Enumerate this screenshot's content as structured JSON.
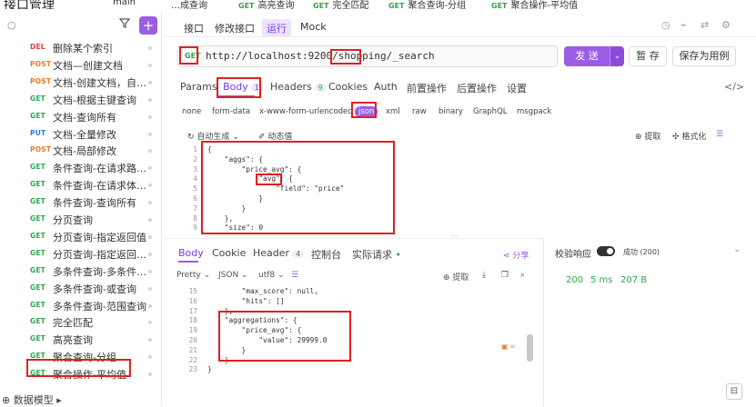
{
  "topbar": {
    "title": "接口管理",
    "tabs": [
      {
        "method": "",
        "label": "main"
      },
      {
        "method": "",
        "label": "…成查询"
      },
      {
        "method": "GET",
        "label": "高亮查询"
      },
      {
        "method": "GET",
        "label": "完全匹配"
      },
      {
        "method": "GET",
        "label": "聚合查询-分组"
      },
      {
        "method": "GET",
        "label": "聚合操作-平均值"
      }
    ]
  },
  "sidebar": {
    "search_icon": "search-icon",
    "add_label": "+",
    "items": [
      {
        "method": "DEL",
        "label": "删除某个索引"
      },
      {
        "method": "POST",
        "label": "文档—创建文档"
      },
      {
        "method": "POST",
        "label": "文档-创建文档，自定..."
      },
      {
        "method": "GET",
        "label": "文档-根据主键查询"
      },
      {
        "method": "GET",
        "label": "文档-查询所有"
      },
      {
        "method": "PUT",
        "label": "文档-全量修改"
      },
      {
        "method": "POST",
        "label": "文档-局部修改"
      },
      {
        "method": "GET",
        "label": "条件查询-在请求路径..."
      },
      {
        "method": "GET",
        "label": "条件查询-在请求体中..."
      },
      {
        "method": "GET",
        "label": "条件查询-查询所有"
      },
      {
        "method": "GET",
        "label": "分页查询"
      },
      {
        "method": "GET",
        "label": "分页查询-指定返回值"
      },
      {
        "method": "GET",
        "label": "分页查询-指定返回值..."
      },
      {
        "method": "GET",
        "label": "多条件查询-多条件同..."
      },
      {
        "method": "GET",
        "label": "多条件查询-或查询"
      },
      {
        "method": "GET",
        "label": "多条件查询-范围查询"
      },
      {
        "method": "GET",
        "label": "完全匹配"
      },
      {
        "method": "GET",
        "label": "高亮查询"
      },
      {
        "method": "GET",
        "label": "聚合查询-分组"
      },
      {
        "method": "GET",
        "label": "聚合操作-平均值"
      }
    ],
    "footer": "数据模型 ▸"
  },
  "main_tabs": [
    "接口",
    "修改接口",
    "运行",
    "Mock"
  ],
  "active_main_tab": "运行",
  "request": {
    "method": "GET",
    "url": "http://localhost:9200/shopping/_search",
    "send": "发 送",
    "save_draft": "暂 存",
    "save_as_case": "保存为用例"
  },
  "req_tabs": [
    {
      "label": "Params",
      "count": ""
    },
    {
      "label": "Body",
      "count": "1"
    },
    {
      "label": "Headers",
      "count": "9"
    },
    {
      "label": "Cookies",
      "count": ""
    },
    {
      "label": "Auth",
      "count": ""
    },
    {
      "label": "前置操作",
      "count": ""
    },
    {
      "label": "后置操作",
      "count": ""
    },
    {
      "label": "设置",
      "count": ""
    }
  ],
  "body_types": [
    "none",
    "form-data",
    "x-www-form-urlencoded",
    "json",
    "xml",
    "raw",
    "binary",
    "GraphQL",
    "msgpack"
  ],
  "body_active": "json",
  "editor_tools": {
    "auto_generate": "自动生成",
    "dynamic_value": "动态值",
    "extract": "提取",
    "format": "格式化"
  },
  "request_body_lines": [
    {
      "n": "1",
      "t": "{"
    },
    {
      "n": "2",
      "t": "    \"aggs\": {"
    },
    {
      "n": "3",
      "t": "        \"price_avg\": {"
    },
    {
      "n": "4",
      "t": "            \"avg\": {"
    },
    {
      "n": "5",
      "t": "                \"field\": \"price\""
    },
    {
      "n": "6",
      "t": "            }"
    },
    {
      "n": "7",
      "t": "        }"
    },
    {
      "n": "8",
      "t": "    },"
    },
    {
      "n": "9",
      "t": "    \"size\": 0"
    }
  ],
  "resp_tabs": [
    {
      "label": "Body",
      "count": ""
    },
    {
      "label": "Cookie",
      "count": ""
    },
    {
      "label": "Header",
      "count": "4"
    },
    {
      "label": "控制台",
      "count": ""
    },
    {
      "label": "实际请求",
      "count": ""
    }
  ],
  "share": "分享",
  "resp_tools": {
    "format": "Pretty",
    "lang": "JSON",
    "charset": "utf8",
    "extract": "提取"
  },
  "response_lines": [
    {
      "n": "15",
      "t": "        \"max_score\": null,"
    },
    {
      "n": "16",
      "t": "        \"hits\": []"
    },
    {
      "n": "17",
      "t": "    },"
    },
    {
      "n": "18",
      "t": "    \"aggregations\": {"
    },
    {
      "n": "19",
      "t": "        \"price_avg\": {"
    },
    {
      "n": "20",
      "t": "            \"value\": 29999.0"
    },
    {
      "n": "21",
      "t": "        }"
    },
    {
      "n": "22",
      "t": "    }"
    },
    {
      "n": "23",
      "t": "}"
    }
  ],
  "verify": {
    "label": "校验响应",
    "result": "成功 (200)",
    "status": "200",
    "time": "5 ms",
    "size": "207 B"
  },
  "colors": {
    "accent": "#9b5de5",
    "highlight_box": "#e02020",
    "get": "#2fa84f",
    "post": "#e67e22",
    "put": "#2c7be5",
    "del": "#e0413b"
  }
}
